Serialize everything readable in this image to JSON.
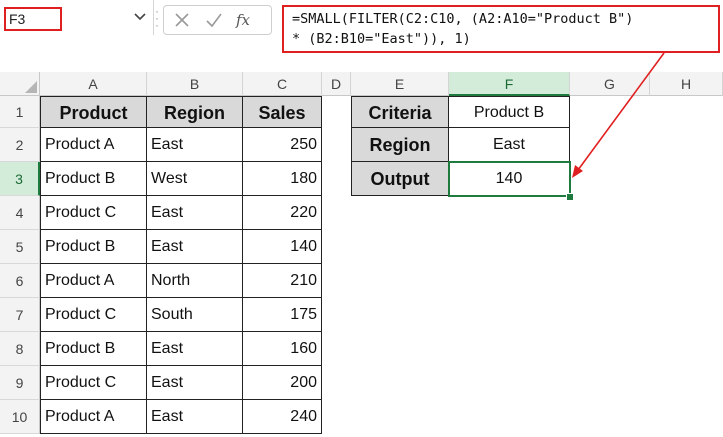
{
  "formula_bar": {
    "name_box": "F3",
    "fx_label": "fx",
    "formula_line1": "=SMALL(FILTER(C2:C10, (A2:A10=\"Product B\")",
    "formula_line2": "* (B2:B10=\"East\")), 1)"
  },
  "columns": [
    "A",
    "B",
    "C",
    "D",
    "E",
    "F",
    "G",
    "H"
  ],
  "rows": [
    "1",
    "2",
    "3",
    "4",
    "5",
    "6",
    "7",
    "8",
    "9",
    "10"
  ],
  "table": {
    "headers": [
      "Product",
      "Region",
      "Sales"
    ],
    "rows": [
      [
        "Product A",
        "East",
        "250"
      ],
      [
        "Product B",
        "West",
        "180"
      ],
      [
        "Product C",
        "East",
        "220"
      ],
      [
        "Product B",
        "East",
        "140"
      ],
      [
        "Product A",
        "North",
        "210"
      ],
      [
        "Product C",
        "South",
        "175"
      ],
      [
        "Product B",
        "East",
        "160"
      ],
      [
        "Product C",
        "East",
        "200"
      ],
      [
        "Product A",
        "East",
        "240"
      ]
    ]
  },
  "criteria": {
    "labels": [
      "Criteria",
      "Region",
      "Output"
    ],
    "values": [
      "Product B",
      "East",
      "140"
    ]
  },
  "colors": {
    "accent_green": "#1f7a3d",
    "highlight_red": "#e02020",
    "header_fill": "#d9d9d9"
  }
}
